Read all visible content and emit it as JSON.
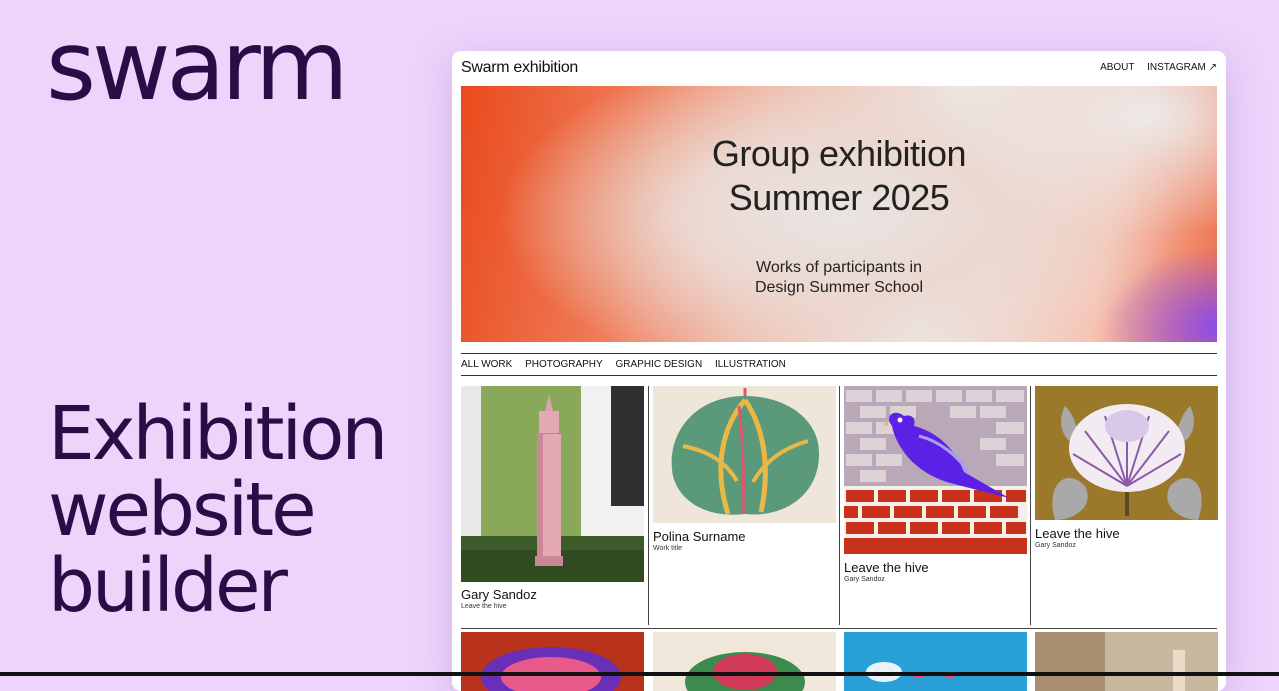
{
  "brand": "swarm",
  "tagline": [
    "Exhibition",
    "website",
    "builder"
  ],
  "site": {
    "title": "Swarm exhibition",
    "nav": [
      "ABOUT",
      "INSTAGRAM ↗"
    ]
  },
  "hero": {
    "title": [
      "Group exhibition",
      "Summer 2025"
    ],
    "subtitle": [
      "Works of participants in",
      "Design Summer School"
    ]
  },
  "filters": [
    "ALL WORK",
    "PHOTOGRAPHY",
    "GRAPHIC DESIGN",
    "ILLUSTRATION"
  ],
  "works": [
    {
      "name": "Gary Sandoz",
      "sub": "Leave the hive"
    },
    {
      "name": "Polina Surname",
      "sub": "Work title"
    },
    {
      "name": "Leave the hive",
      "sub": "Gary Sandoz"
    },
    {
      "name": "Leave the hive",
      "sub": "Gary Sandoz"
    }
  ],
  "colors": {
    "background": "#ecd4fb",
    "brand_text": "#2a0d47",
    "hero_orange": "#e94a1c",
    "hero_purple": "#8a4cf0"
  }
}
